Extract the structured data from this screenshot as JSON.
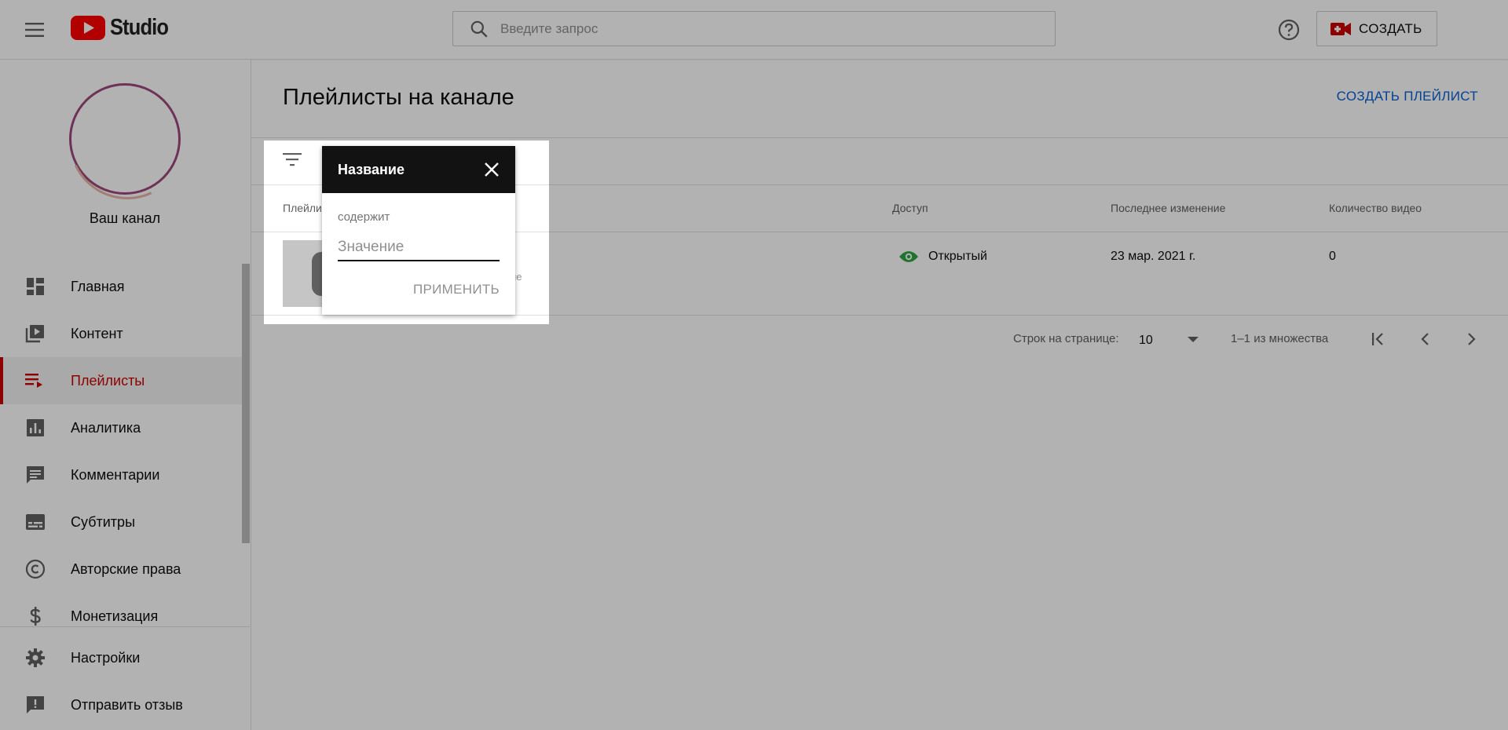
{
  "header": {
    "logo_text": "Studio",
    "search_placeholder": "Введите запрос",
    "create_label": "СОЗДАТЬ"
  },
  "sidebar": {
    "channel_name": "Ваш канал",
    "items": [
      {
        "label": "Главная",
        "icon": "dashboard-icon"
      },
      {
        "label": "Контент",
        "icon": "video-library-icon"
      },
      {
        "label": "Плейлисты",
        "icon": "playlist-icon",
        "active": true
      },
      {
        "label": "Аналитика",
        "icon": "analytics-icon"
      },
      {
        "label": "Комментарии",
        "icon": "comment-icon"
      },
      {
        "label": "Субтитры",
        "icon": "subtitles-icon"
      },
      {
        "label": "Авторские права",
        "icon": "copyright-icon"
      },
      {
        "label": "Монетизация",
        "icon": "dollar-icon"
      },
      {
        "label": "Настройки",
        "icon": "gear-icon"
      },
      {
        "label": "Отправить отзыв",
        "icon": "feedback-icon"
      }
    ]
  },
  "main": {
    "title": "Плейлисты на канале",
    "create_playlist": "СОЗДАТЬ ПЛЕЙЛИСТ",
    "columns": {
      "playlist": "Плейли",
      "access": "Доступ",
      "modified": "Последнее изменение",
      "video_count": "Количество видео"
    },
    "rows": [
      {
        "access": "Открытый",
        "modified": "23 мар. 2021 г.",
        "video_count": "0",
        "partial_text": "ие"
      }
    ],
    "pager": {
      "rows_per_page_label": "Строк на странице:",
      "rows_per_page": "10",
      "range": "1–1 из множества"
    }
  },
  "filter_popup": {
    "title": "Название",
    "operator": "содержит",
    "value_placeholder": "Значение",
    "apply_label": "ПРИМЕНИТЬ"
  },
  "colors": {
    "brand_red": "#cc0000",
    "link_blue": "#065fd4",
    "access_green": "#2ba640"
  }
}
